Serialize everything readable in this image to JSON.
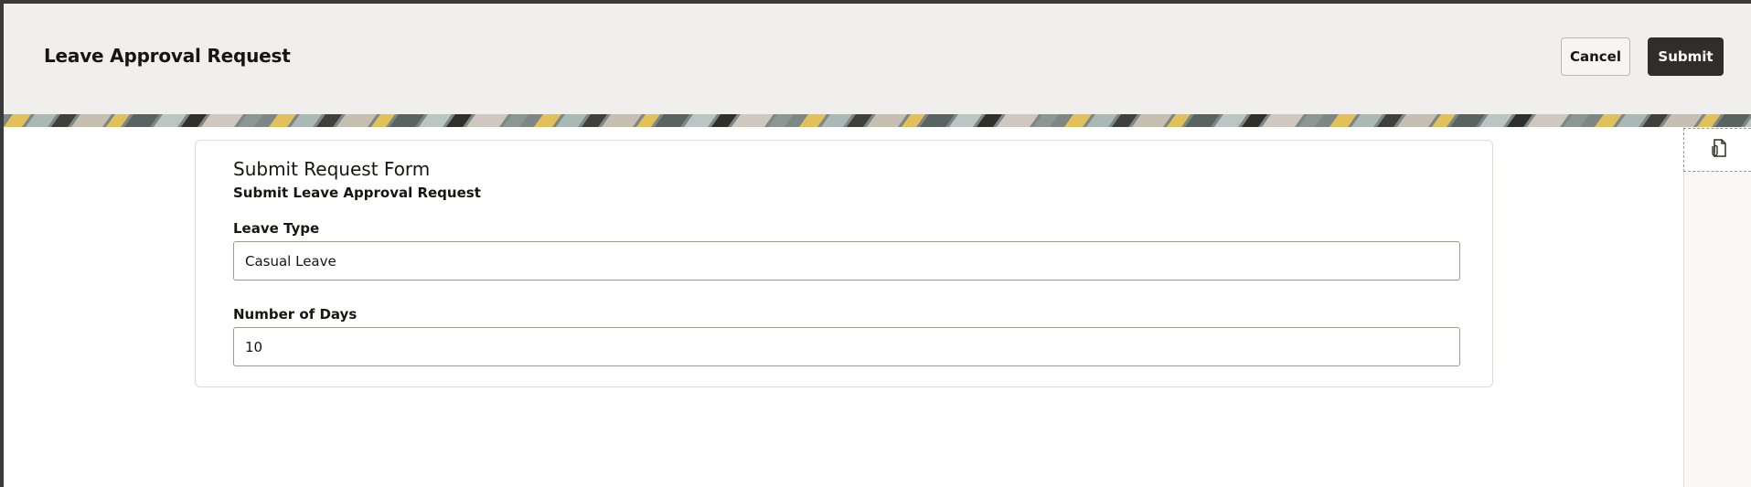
{
  "header": {
    "title": "Leave Approval Request",
    "cancel_label": "Cancel",
    "submit_label": "Submit"
  },
  "side_rail": {
    "icon": "attachment-document-icon"
  },
  "form": {
    "title": "Submit Request Form",
    "subtitle": "Submit Leave Approval Request",
    "fields": [
      {
        "label": "Leave Type",
        "value": "Casual Leave"
      },
      {
        "label": "Number of Days",
        "value": "10"
      }
    ]
  },
  "colors": {
    "header_bg": "#f1efed",
    "primary_button": "#312d2a",
    "banner_accent": "#e6be4e"
  }
}
